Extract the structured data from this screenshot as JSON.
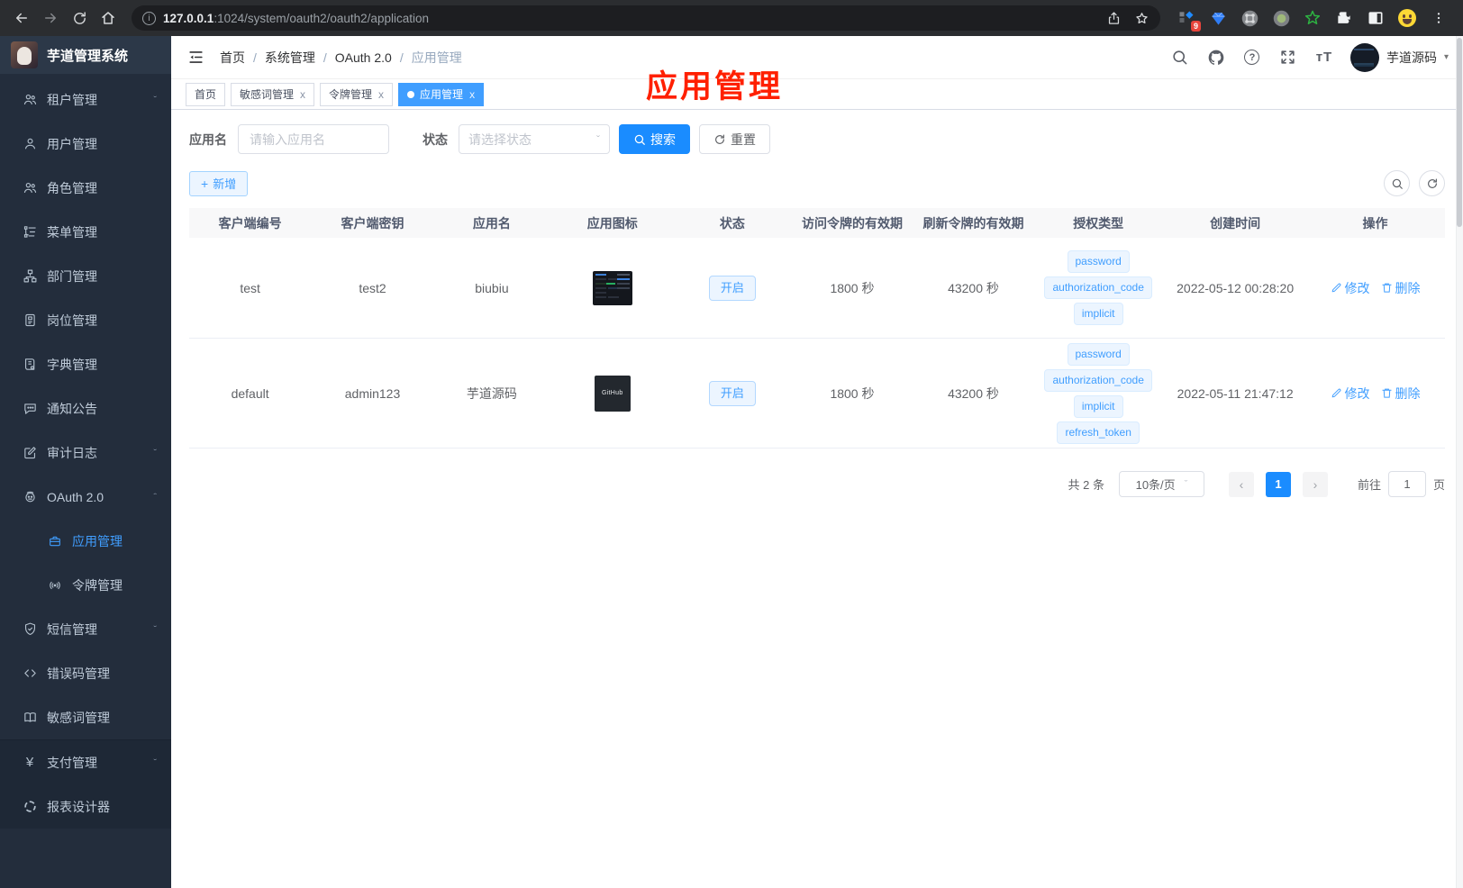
{
  "glyphs": {
    "slash": "/",
    "close": "x",
    "chev_down": "ˇ",
    "chev_up": "ˆ",
    "caret_down": "▾",
    "prev": "‹",
    "next": "›",
    "plus": "+",
    "more": "⋮",
    "help": "?",
    "yen": "¥"
  },
  "browser": {
    "url_host": "127.0.0.1",
    "url_path": ":1024/system/oauth2/oauth2/application",
    "ext_badge": "9"
  },
  "sidebar": {
    "logo_title": "芋道管理系统",
    "items": [
      {
        "label": "租户管理"
      },
      {
        "label": "用户管理"
      },
      {
        "label": "角色管理"
      },
      {
        "label": "菜单管理"
      },
      {
        "label": "部门管理"
      },
      {
        "label": "岗位管理"
      },
      {
        "label": "字典管理"
      },
      {
        "label": "通知公告"
      },
      {
        "label": "审计日志"
      },
      {
        "label": "OAuth 2.0"
      },
      {
        "label": "应用管理"
      },
      {
        "label": "令牌管理"
      },
      {
        "label": "短信管理"
      },
      {
        "label": "错误码管理"
      },
      {
        "label": "敏感词管理"
      },
      {
        "label": "支付管理"
      },
      {
        "label": "报表设计器"
      }
    ]
  },
  "header": {
    "breadcrumb": [
      "首页",
      "系统管理",
      "OAuth 2.0",
      "应用管理"
    ],
    "font_size_icon": "тT",
    "username": "芋道源码"
  },
  "tabs": [
    {
      "label": "首页"
    },
    {
      "label": "敏感词管理"
    },
    {
      "label": "令牌管理"
    },
    {
      "label": "应用管理"
    }
  ],
  "annotation": {
    "text": "应用管理",
    "color": "#ff2000"
  },
  "filters": {
    "name_label": "应用名",
    "name_placeholder": "请输入应用名",
    "status_label": "状态",
    "status_placeholder": "请选择状态",
    "search_label": "搜索",
    "reset_label": "重置"
  },
  "toolbar": {
    "add_label": "新增"
  },
  "table": {
    "columns": [
      "客户端编号",
      "客户端密钥",
      "应用名",
      "应用图标",
      "状态",
      "访问令牌的有效期",
      "刷新令牌的有效期",
      "授权类型",
      "创建时间",
      "操作"
    ],
    "rows": [
      {
        "client_id": "test",
        "client_secret": "test2",
        "name": "biubiu",
        "status": "开启",
        "access_ttl": "1800 秒",
        "refresh_ttl": "43200 秒",
        "grants": [
          "password",
          "authorization_code",
          "implicit"
        ],
        "created": "2022-05-12 00:28:20",
        "edit_label": "修改",
        "delete_label": "删除"
      },
      {
        "client_id": "default",
        "client_secret": "admin123",
        "name": "芋道源码",
        "icon_text": "GitHub",
        "status": "开启",
        "access_ttl": "1800 秒",
        "refresh_ttl": "43200 秒",
        "grants": [
          "password",
          "authorization_code",
          "implicit",
          "refresh_token"
        ],
        "created": "2022-05-11 21:47:12",
        "edit_label": "修改",
        "delete_label": "删除"
      }
    ]
  },
  "pagination": {
    "total": "共 2 条",
    "page_size": "10条/页",
    "current": "1",
    "goto_label": "前往",
    "goto_value": "1",
    "page_label": "页"
  }
}
